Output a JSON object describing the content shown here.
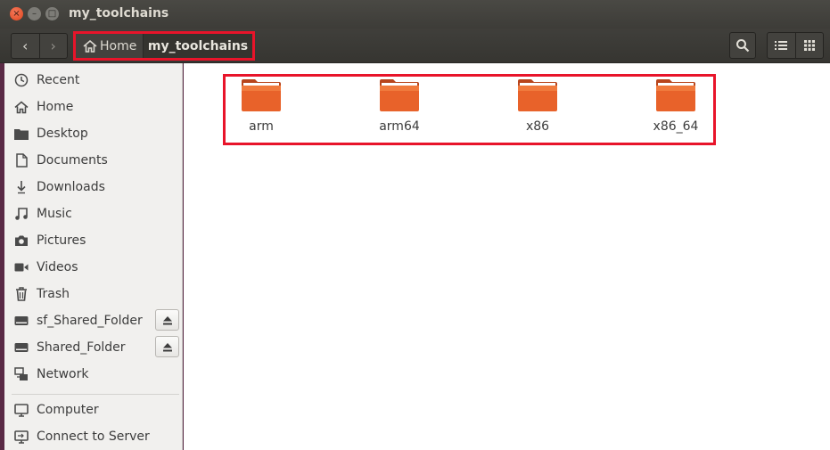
{
  "window": {
    "title": "my_toolchains",
    "close_glyph": "×",
    "minimize_glyph": "–",
    "maximize_glyph": "□"
  },
  "toolbar": {
    "back_glyph": "‹",
    "forward_glyph": "›",
    "breadcrumb": [
      {
        "label": "Home",
        "icon": "home-icon"
      },
      {
        "label": "my_toolchains"
      }
    ],
    "search_icon": "search-icon",
    "view_icons": [
      "list-view-icon",
      "grid-view-icon"
    ]
  },
  "sidebar": {
    "items": [
      {
        "label": "Recent",
        "icon": "clock-icon"
      },
      {
        "label": "Home",
        "icon": "home-icon"
      },
      {
        "label": "Desktop",
        "icon": "folder-icon"
      },
      {
        "label": "Documents",
        "icon": "document-icon"
      },
      {
        "label": "Downloads",
        "icon": "download-icon"
      },
      {
        "label": "Music",
        "icon": "music-icon"
      },
      {
        "label": "Pictures",
        "icon": "camera-icon"
      },
      {
        "label": "Videos",
        "icon": "video-icon"
      },
      {
        "label": "Trash",
        "icon": "trash-icon"
      },
      {
        "label": "sf_Shared_Folder",
        "icon": "drive-icon",
        "eject": true
      },
      {
        "label": "Shared_Folder",
        "icon": "drive-icon",
        "eject": true
      },
      {
        "label": "Network",
        "icon": "network-icon"
      },
      {
        "label": "Computer",
        "icon": "computer-icon"
      },
      {
        "label": "Connect to Server",
        "icon": "server-icon"
      }
    ]
  },
  "files": [
    {
      "name": "arm",
      "icon": "folder-icon"
    },
    {
      "name": "arm64",
      "icon": "folder-icon"
    },
    {
      "name": "x86",
      "icon": "folder-icon"
    },
    {
      "name": "x86_64",
      "icon": "folder-icon"
    }
  ],
  "colors": {
    "highlight": "#e8142a",
    "folder_orange": "#e8622a"
  }
}
